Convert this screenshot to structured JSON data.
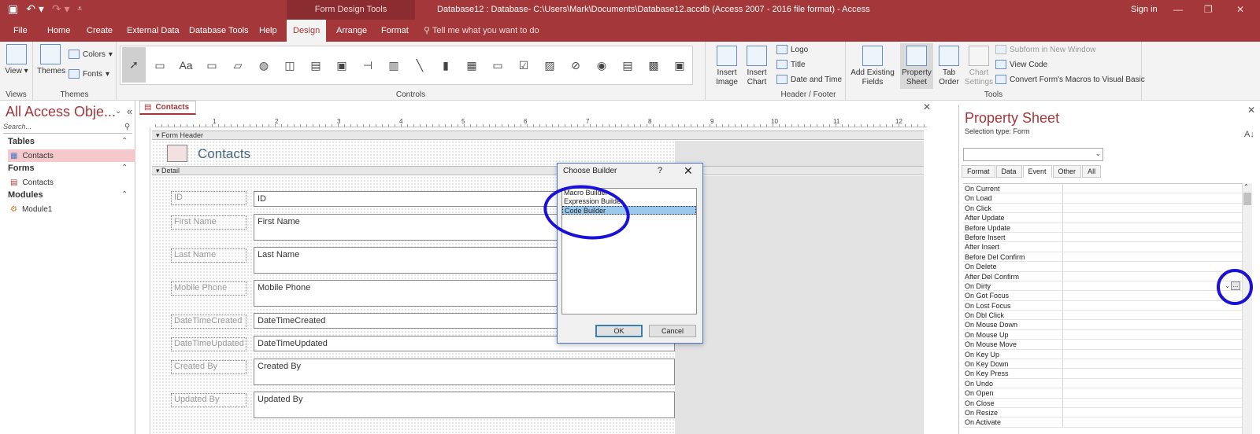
{
  "qat": {
    "save_icon": "save-icon",
    "undo_icon": "undo-icon",
    "redo_icon": "redo-icon",
    "customize_icon": "customize-qat-icon"
  },
  "contextual_header": "Form Design Tools",
  "window_title": "Database12 : Database- C:\\Users\\Mark\\Documents\\Database12.accdb (Access 2007 - 2016 file format)  -  Access",
  "signin": "Sign in",
  "window_controls": {
    "minimize": "—",
    "restore": "❐",
    "close": "✕"
  },
  "tabs": [
    "File",
    "Home",
    "Create",
    "External Data",
    "Database Tools",
    "Help",
    "Design",
    "Arrange",
    "Format"
  ],
  "tell_me": "Tell me what you want to do",
  "ribbon": {
    "views": {
      "label": "View",
      "group": "Views"
    },
    "themes": {
      "label": "Themes",
      "colors": "Colors",
      "fonts": "Fonts",
      "group": "Themes"
    },
    "controls_group": "Controls",
    "insert_image": "Insert Image",
    "insert_chart": "Insert Chart",
    "header_footer": {
      "logo": "Logo",
      "title": "Title",
      "date_time": "Date and Time",
      "group": "Header / Footer"
    },
    "tools": {
      "add_existing": "Add Existing Fields",
      "property_sheet": "Property Sheet",
      "tab_order": "Tab Order",
      "chart_settings": "Chart Settings",
      "subform": "Subform in New Window",
      "view_code": "View Code",
      "convert": "Convert Form's Macros to Visual Basic",
      "group": "Tools"
    }
  },
  "nav": {
    "title": "All Access Obje...",
    "search_placeholder": "Search...",
    "sections": [
      {
        "name": "Tables",
        "items": [
          "Contacts"
        ]
      },
      {
        "name": "Forms",
        "items": [
          "Contacts"
        ]
      },
      {
        "name": "Modules",
        "items": [
          "Module1"
        ]
      }
    ]
  },
  "document": {
    "tab": "Contacts",
    "ruler_numbers": [
      "1",
      "2",
      "3",
      "4",
      "5",
      "6",
      "7",
      "8",
      "9",
      "10",
      "11",
      "12"
    ],
    "form_header": "Form Header",
    "header_title": "Contacts",
    "detail": "Detail",
    "fields": [
      {
        "label": "ID",
        "value": "ID"
      },
      {
        "label": "First Name",
        "value": "First Name"
      },
      {
        "label": "Last Name",
        "value": "Last Name"
      },
      {
        "label": "Mobile Phone",
        "value": "Mobile Phone"
      },
      {
        "label": "DateTimeCreated",
        "value": "DateTimeCreated"
      },
      {
        "label": "DateTimeUpdated",
        "value": "DateTimeUpdated"
      },
      {
        "label": "Created By",
        "value": "Created By"
      },
      {
        "label": "Updated By",
        "value": "Updated By"
      }
    ]
  },
  "dialog": {
    "title": "Choose Builder",
    "help": "?",
    "close": "✕",
    "options": [
      "Macro Builder",
      "Expression Builder",
      "Code Builder"
    ],
    "selected": "Code Builder",
    "ok": "OK",
    "cancel": "Cancel"
  },
  "property_sheet": {
    "title": "Property Sheet",
    "selection_type": "Selection type:  Form",
    "tabs": [
      "Format",
      "Data",
      "Event",
      "Other",
      "All"
    ],
    "active_tab": "Event",
    "rows": [
      "On Current",
      "On Load",
      "On Click",
      "After Update",
      "Before Update",
      "Before Insert",
      "After Insert",
      "Before Del Confirm",
      "On Delete",
      "After Del Confirm",
      "On Dirty",
      "On Got Focus",
      "On Lost Focus",
      "On Dbl Click",
      "On Mouse Down",
      "On Mouse Up",
      "On Mouse Move",
      "On Key Up",
      "On Key Down",
      "On Key Press",
      "On Undo",
      "On Open",
      "On Close",
      "On Resize",
      "On Activate"
    ],
    "builder_button": "...",
    "sort_icon": "sort-az-icon"
  },
  "colors": {
    "accent": "#a4373a",
    "annotation": "#1a11d8"
  }
}
